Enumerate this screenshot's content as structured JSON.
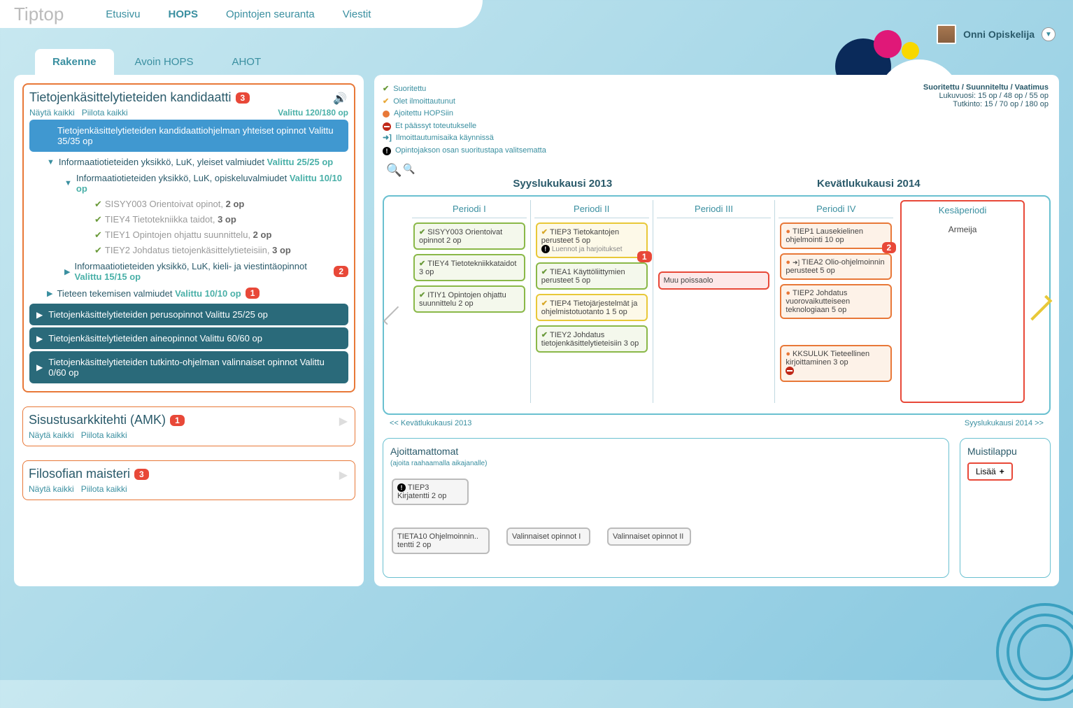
{
  "logo": "Tiptop",
  "topnav": [
    "Etusivu",
    "HOPS",
    "Opintojen seuranta",
    "Viestit"
  ],
  "topnav_active": 1,
  "user": {
    "name": "Onni Opiskelija"
  },
  "subtabs": [
    "Rakenne",
    "Avoin HOPS",
    "AHOT"
  ],
  "subtabs_active": 0,
  "degree1": {
    "title": "Tietojenkäsittelytieteiden kandidaatti",
    "badge": "3",
    "show_all": "Näytä kaikki",
    "hide_all": "Piilota kaikki",
    "selected": "Valittu 120/180 op",
    "row1": "Tietojenkäsittelytieteiden kandidaattiohjelman yhteiset opinnot Valittu 35/35 op",
    "row2": "Informaatiotieteiden yksikkö, LuK, yleiset valmiudet",
    "row2_sel": "Valittu 25/25 op",
    "row3": "Informaatiotieteiden yksikkö, LuK, opiskeluvalmiudet",
    "row3_sel": "Valittu 10/10 op",
    "c1": "SISYY003 Orientoivat opinot,",
    "c1_op": "2 op",
    "c2": "TIEY4 Tietotekniikka taidot,",
    "c2_op": "3 op",
    "c3": "TIEY1 Opintojen ohjattu suunnittelu,",
    "c3_op": "2 op",
    "c4": "TIEY2 Johdatus tietojenkäsittelytieteisiin,",
    "c4_op": "3 op",
    "row4": "Informaatiotieteiden yksikkö, LuK, kieli- ja viestintäopinnot",
    "row4_sel": "Valittu 15/15 op",
    "row4_badge": "2",
    "row5": "Tieteen tekemisen valmiudet",
    "row5_sel": "Valittu 10/10 op",
    "row5_badge": "1",
    "teal1": "Tietojenkäsittelytieteiden perusopinnot Valittu 25/25 op",
    "teal2": "Tietojenkäsittelytieteiden aineopinnot Valittu 60/60 op",
    "teal3": "Tietojenkäsittelytieteiden tutkinto-ohjelman valinnaiset opinnot Valittu 0/60 op"
  },
  "degree2": {
    "title": "Sisustusarkkitehti (AMK)",
    "badge": "1",
    "show_all": "Näytä kaikki",
    "hide_all": "Piilota kaikki"
  },
  "degree3": {
    "title": "Filosofian maisteri",
    "badge": "3",
    "show_all": "Näytä kaikki",
    "hide_all": "Piilota kaikki"
  },
  "legend": {
    "l1": "Suoritettu",
    "l2": "Olet ilmoittautunut",
    "l3": "Ajoitettu HOPSiin",
    "l4": "Et päässyt toteutukselle",
    "l5": "Ilmoittautumisaika käynnissä",
    "l6": "Opintojakson osan suoritustapa valitsematta"
  },
  "stats": {
    "h": "Suoritettu / Suunniteltu / Vaatimus",
    "r1": "Lukuvuosi: 15 op / 48 op / 55 op",
    "r2": "Tutkinto: 15 / 70 op / 180 op"
  },
  "sem1": "Syyslukukausi 2013",
  "sem2": "Kevätlukukausi 2014",
  "periods": [
    "Periodi I",
    "Periodi II",
    "Periodi III",
    "Periodi IV",
    "Kesäperiodi"
  ],
  "p1": {
    "c1": "SISYY003 Orientoivat opinnot 2 op",
    "c2": "TIEY4 Tietotekniikkataidot 3 op",
    "c3": "ITIY1 Opintojen ohjattu suunnittelu 2 op"
  },
  "p2": {
    "c1": "TIEP3 Tietokantojen perusteet 5 op",
    "c1_sub": "Luennot ja harjoitukset",
    "c1_badge": "1",
    "c2": "TIEA1 Käyttöliittymien perusteet 5 op",
    "c3": "TIEP4 Tietojärjestelmät ja ohjelmistotuotanto 1 5 op",
    "c4": "TIEY2 Johdatus tietojenkäsittelytieteisiin 3 op"
  },
  "p3": {
    "c1": "Muu poissaolo"
  },
  "p4": {
    "c1": "TIEP1 Lausekielinen ohjelmointi 10 op",
    "c1_badge": "2",
    "c2": "TIEA2 Olio-ohjelmoinnin perusteet 5 op",
    "c3": "TIEP2 Johdatus vuorovaikutteiseen teknologiaan 5 op",
    "c4": "KKSULUK Tieteellinen kirjoittaminen 3 op"
  },
  "p5": {
    "c1": "Armeija"
  },
  "prev_sem": "<< Kevätlukukausi 2013",
  "next_sem": "Syyslukukausi 2014 >>",
  "unscheduled": {
    "title": "Ajoittamattomat",
    "hint": "(ajoita raahaamalla aikajanalle)",
    "c1": "TIEP3 Kirjatentti 2 op",
    "c2": "TIETA10  Ohjelmoinnin.. tentti 2 op",
    "c3": "Valinnaiset opinnot I",
    "c4": "Valinnaiset opinnot II"
  },
  "notes": {
    "title": "Muistilappu",
    "add": "Lisää"
  }
}
